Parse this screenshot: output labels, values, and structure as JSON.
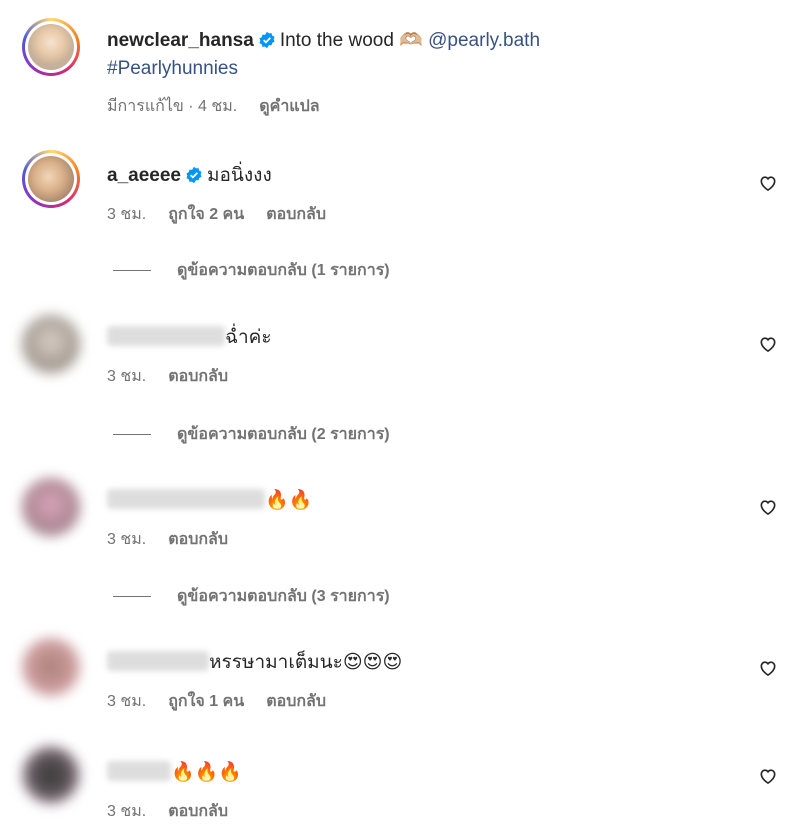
{
  "caption": {
    "username": "newclear_hansa",
    "text": "Into the wood 🫶🏼",
    "mention": "@pearly.bath",
    "hashtag": "#Pearlyhunnies",
    "edited": "มีการแก้ไข · 4 ชม.",
    "translate": "ดูคำแปล"
  },
  "comments": [
    {
      "username": "a_aeeee",
      "verified": true,
      "text": "มอนิ่งงง",
      "time": "3 ชม.",
      "likes": "ถูกใจ 2 คน",
      "reply": "ตอบกลับ",
      "view_replies": "ดูข้อความตอบกลับ (1 รายการ)"
    },
    {
      "username": "",
      "text": "ฉ่ำค่ะ",
      "time": "3 ชม.",
      "reply": "ตอบกลับ",
      "view_replies": "ดูข้อความตอบกลับ (2 รายการ)"
    },
    {
      "username": "",
      "text": "🔥🔥",
      "time": "3 ชม.",
      "reply": "ตอบกลับ",
      "view_replies": "ดูข้อความตอบกลับ (3 รายการ)"
    },
    {
      "username": "",
      "text": "หรรษามาเต็มนะ😍😍😍",
      "time": "3 ชม.",
      "likes": "ถูกใจ 1 คน",
      "reply": "ตอบกลับ"
    },
    {
      "username": "",
      "text": "🔥🔥🔥",
      "time": "3 ชม.",
      "reply": "ตอบกลับ"
    }
  ],
  "colors": {
    "link": "#385185",
    "meta": "#737373",
    "verified": "#0095f6"
  },
  "icons": {
    "like": "heart-outline-icon",
    "verified": "verified-badge-icon"
  }
}
